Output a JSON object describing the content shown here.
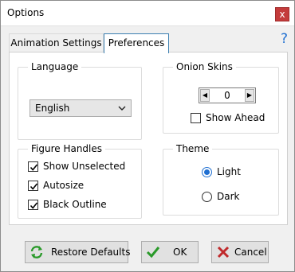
{
  "window": {
    "title": "Options",
    "close_glyph": "x",
    "close_color": "#c43b3b"
  },
  "tabs": [
    {
      "label": "Animation Settings",
      "active": false
    },
    {
      "label": "Preferences",
      "active": true
    }
  ],
  "help_glyph": "?",
  "language": {
    "title": "Language",
    "selected": "English",
    "icon": "chevron-down-icon"
  },
  "onion_skins": {
    "title": "Onion Skins",
    "value": "0",
    "show_ahead_label": "Show Ahead",
    "show_ahead_checked": false
  },
  "figure_handles": {
    "title": "Figure Handles",
    "items": [
      {
        "label": "Show Unselected",
        "checked": true
      },
      {
        "label": "Autosize",
        "checked": true
      },
      {
        "label": "Black Outline",
        "checked": true
      }
    ]
  },
  "theme": {
    "title": "Theme",
    "options": [
      {
        "label": "Light",
        "selected": true
      },
      {
        "label": "Dark",
        "selected": false
      }
    ],
    "accent": "#1f6fd1"
  },
  "buttons": {
    "restore": {
      "label": "Restore Defaults",
      "icon": "refresh-icon"
    },
    "ok": {
      "label": "OK",
      "icon": "checkmark-icon"
    },
    "cancel": {
      "label": "Cancel",
      "icon": "x-icon"
    }
  }
}
